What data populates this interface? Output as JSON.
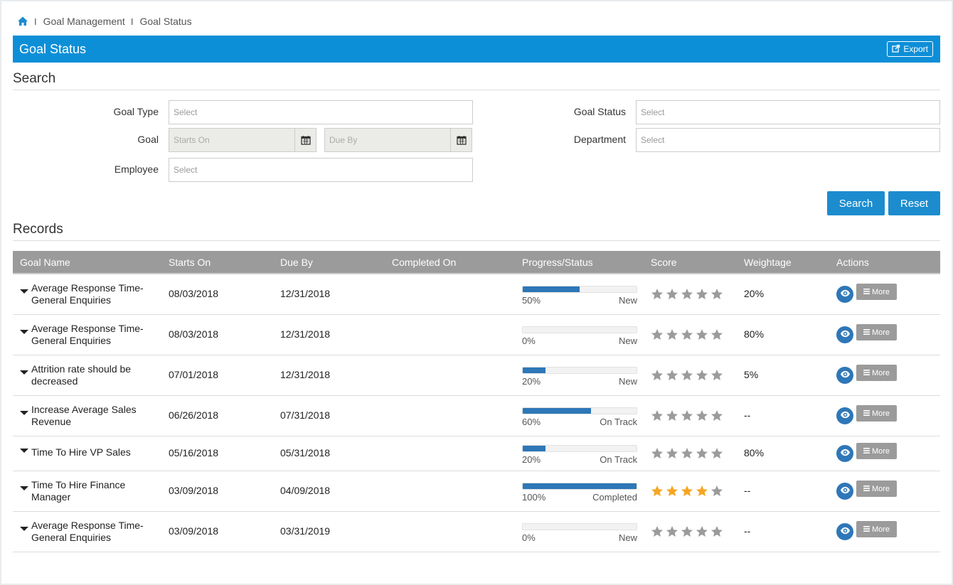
{
  "breadcrumb": {
    "items": [
      "Goal Management",
      "Goal Status"
    ],
    "separator": "I"
  },
  "header": {
    "title": "Goal Status",
    "export_label": "Export"
  },
  "search": {
    "heading": "Search",
    "goal_type_label": "Goal Type",
    "goal_type_placeholder": "Select",
    "goal_label": "Goal",
    "starts_on_placeholder": "Starts On",
    "due_by_placeholder": "Due By",
    "employee_label": "Employee",
    "employee_placeholder": "Select",
    "goal_status_label": "Goal Status",
    "goal_status_placeholder": "Select",
    "department_label": "Department",
    "department_placeholder": "Select",
    "search_button": "Search",
    "reset_button": "Reset"
  },
  "records": {
    "heading": "Records",
    "columns": [
      "Goal Name",
      "Starts On",
      "Due By",
      "Completed On",
      "Progress/Status",
      "Score",
      "Weightage",
      "Actions"
    ],
    "more_label": "More",
    "rows": [
      {
        "name": "Average Response Time-General Enquiries",
        "line1": "Average Response Time-",
        "line2": "General Enquiries",
        "starts_on": "08/03/2018",
        "due_by": "12/31/2018",
        "completed_on": "",
        "progress": 50,
        "progress_text": "50%",
        "status": "New",
        "score": 0,
        "weightage": "20%"
      },
      {
        "name": "Average Response Time-General Enquiries",
        "line1": "Average Response Time-",
        "line2": "General Enquiries",
        "starts_on": "08/03/2018",
        "due_by": "12/31/2018",
        "completed_on": "",
        "progress": 0,
        "progress_text": "0%",
        "status": "New",
        "score": 0,
        "weightage": "80%"
      },
      {
        "name": "Attrition rate should be decreased",
        "line1": "Attrition rate should be",
        "line2": "decreased",
        "starts_on": "07/01/2018",
        "due_by": "12/31/2018",
        "completed_on": "",
        "progress": 20,
        "progress_text": "20%",
        "status": "New",
        "score": 0,
        "weightage": "5%"
      },
      {
        "name": "Increase Average Sales Revenue",
        "line1": "Increase Average Sales",
        "line2": "Revenue",
        "starts_on": "06/26/2018",
        "due_by": "07/31/2018",
        "completed_on": "",
        "progress": 60,
        "progress_text": "60%",
        "status": "On Track",
        "score": 0,
        "weightage": "--"
      },
      {
        "name": "Time To Hire VP Sales",
        "line1": "Time To Hire VP Sales",
        "line2": "",
        "starts_on": "05/16/2018",
        "due_by": "05/31/2018",
        "completed_on": "",
        "progress": 20,
        "progress_text": "20%",
        "status": "On Track",
        "score": 0,
        "weightage": "80%"
      },
      {
        "name": "Time To Hire Finance Manager",
        "line1": "Time To Hire Finance",
        "line2": "Manager",
        "starts_on": "03/09/2018",
        "due_by": "04/09/2018",
        "completed_on": "",
        "progress": 100,
        "progress_text": "100%",
        "status": "Completed",
        "score": 4,
        "weightage": "--"
      },
      {
        "name": "Average Response Time-General Enquiries",
        "line1": "Average Response Time-",
        "line2": "General Enquiries",
        "starts_on": "03/09/2018",
        "due_by": "03/31/2019",
        "completed_on": "",
        "progress": 0,
        "progress_text": "0%",
        "status": "New",
        "score": 0,
        "weightage": "--"
      }
    ]
  },
  "colors": {
    "header_bg": "#0d8fd8",
    "button_bg": "#1c8ccf",
    "progress_fill": "#2e77b8",
    "star_on": "#f5a623",
    "star_off": "#9b9b9b"
  }
}
